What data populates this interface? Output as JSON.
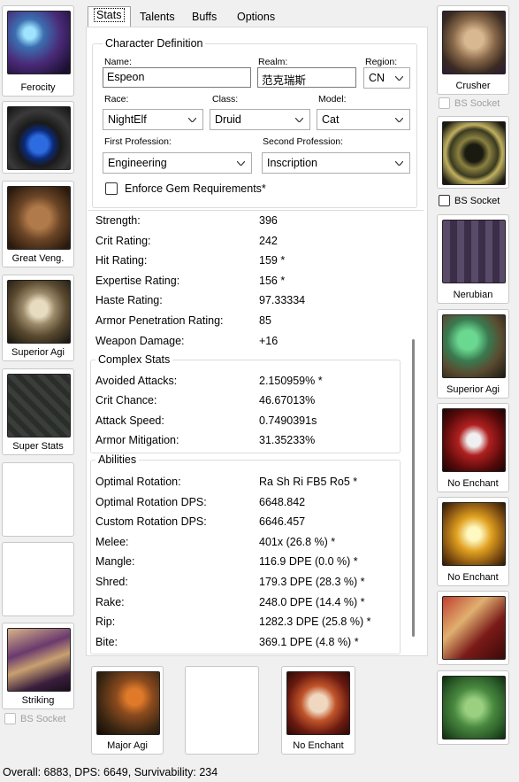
{
  "tabs": [
    {
      "label": "Stats",
      "active": true
    },
    {
      "label": "Talents"
    },
    {
      "label": "Buffs"
    },
    {
      "label": "Options"
    }
  ],
  "character": {
    "group_title": "Character Definition",
    "name_label": "Name:",
    "name_value": "Espeon",
    "realm_label": "Realm:",
    "realm_value": "范克瑞斯",
    "region_label": "Region:",
    "region_value": "CN",
    "race_label": "Race:",
    "race_value": "NightElf",
    "class_label": "Class:",
    "class_value": "Druid",
    "model_label": "Model:",
    "model_value": "Cat",
    "prof1_label": "First Profession:",
    "prof1_value": "Engineering",
    "prof2_label": "Second Profession:",
    "prof2_value": "Inscription",
    "enforce_label": "Enforce Gem Requirements*",
    "enforce_checked": false
  },
  "basic_stats": [
    {
      "name": "Strength:",
      "value": "396"
    },
    {
      "name": "Crit Rating:",
      "value": "242"
    },
    {
      "name": "Hit Rating:",
      "value": "159 *"
    },
    {
      "name": "Expertise Rating:",
      "value": "156 *"
    },
    {
      "name": "Haste Rating:",
      "value": "97.33334"
    },
    {
      "name": "Armor Penetration Rating:",
      "value": "85"
    },
    {
      "name": "Weapon Damage:",
      "value": "+16"
    }
  ],
  "complex": {
    "title": "Complex Stats",
    "rows": [
      {
        "name": "Avoided Attacks:",
        "value": "2.150959% *"
      },
      {
        "name": "Crit Chance:",
        "value": "46.67013%"
      },
      {
        "name": "Attack Speed:",
        "value": "0.7490391s"
      },
      {
        "name": "Armor Mitigation:",
        "value": "31.35233%"
      }
    ]
  },
  "abilities": {
    "title": "Abilities",
    "rows": [
      {
        "name": "Optimal Rotation:",
        "value": "Ra Sh Ri FB5 Ro5 *"
      },
      {
        "name": "Optimal Rotation DPS:",
        "value": "6648.842"
      },
      {
        "name": "Custom Rotation DPS:",
        "value": "6646.457"
      },
      {
        "name": "Melee:",
        "value": "401x  (26.8 %) *"
      },
      {
        "name": "Mangle:",
        "value": "116.9 DPE  (0.0 %) *"
      },
      {
        "name": "Shred:",
        "value": "179.3 DPE  (28.3 %) *"
      },
      {
        "name": "Rake:",
        "value": "248.0 DPE  (14.4 %) *"
      },
      {
        "name": "Rip:",
        "value": "1282.3 DPE  (25.8 %) *"
      },
      {
        "name": "Bite:",
        "value": "369.1 DPE  (4.8 %) *"
      }
    ]
  },
  "left_slots": [
    {
      "label": "Ferocity",
      "icon": "head-icon"
    },
    {
      "label": "",
      "icon": "neck-icon"
    },
    {
      "label": "Great Veng.",
      "icon": "shoulder-icon"
    },
    {
      "label": "Superior Agi",
      "icon": "back-icon"
    },
    {
      "label": "Super Stats",
      "icon": "chest-icon"
    },
    {
      "label": "",
      "icon": "shirt-slot-empty"
    },
    {
      "label": "",
      "icon": "tabard-slot-empty"
    },
    {
      "label": "Striking",
      "icon": "wrist-icon"
    }
  ],
  "left_bs_socket": "BS Socket",
  "right_slots": [
    {
      "label": "Crusher",
      "icon": "hands-icon"
    },
    {
      "label": "",
      "icon": "waist-icon"
    },
    {
      "label": "Nerubian",
      "icon": "legs-icon"
    },
    {
      "label": "Superior Agi",
      "icon": "feet-icon"
    },
    {
      "label": "No Enchant",
      "icon": "ring1-icon"
    },
    {
      "label": "No Enchant",
      "icon": "ring2-icon"
    },
    {
      "label": "",
      "icon": "trinket1-icon"
    },
    {
      "label": "",
      "icon": "trinket2-icon"
    }
  ],
  "right_bs_socket_1": "BS Socket",
  "right_bs_socket_2": "BS Socket",
  "bottom_slots": [
    {
      "label": "Major Agi",
      "icon": "weapon-icon"
    },
    {
      "label": "",
      "icon": "offhand-empty"
    },
    {
      "label": "No Enchant",
      "icon": "idol-icon"
    }
  ],
  "footer": "Overall: 6883, DPS: 6649, Survivability: 234",
  "colors": {
    "window_bg": "#f0f0f0",
    "panel_bg": "#ffffff",
    "border": "#c8c8c8"
  }
}
